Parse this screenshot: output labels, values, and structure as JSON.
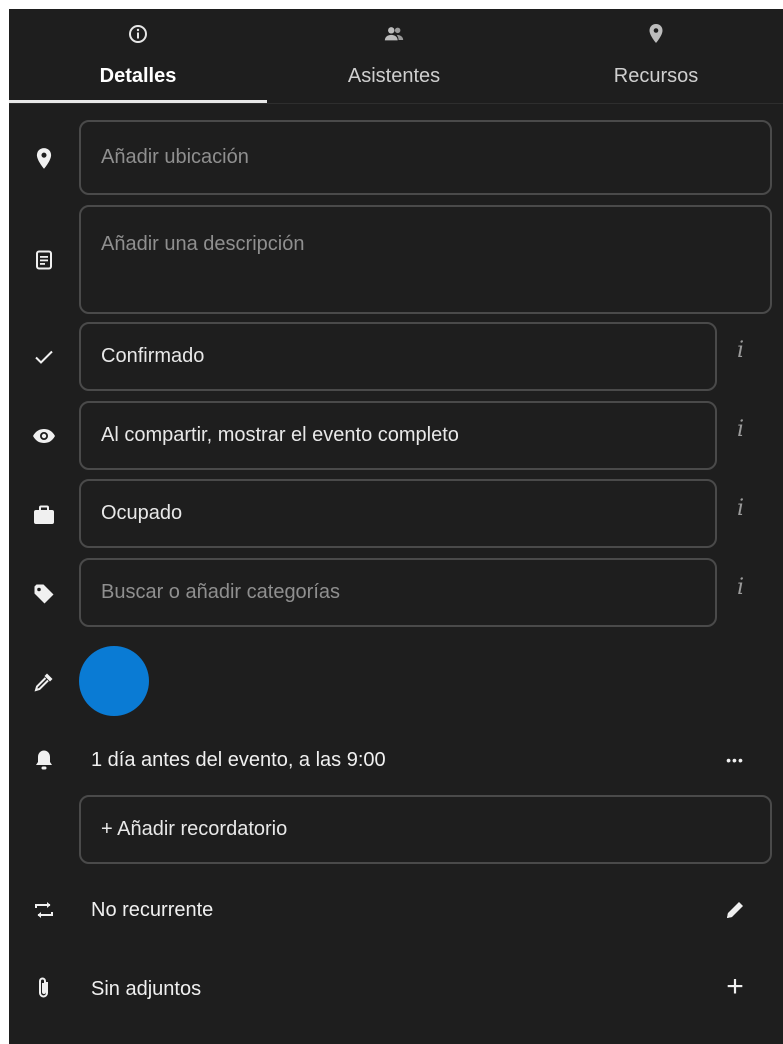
{
  "tabs": [
    {
      "label": "Detalles",
      "icon": "info-icon",
      "active": true
    },
    {
      "label": "Asistentes",
      "icon": "people-icon",
      "active": false
    },
    {
      "label": "Recursos",
      "icon": "location-pin-icon",
      "active": false
    }
  ],
  "location": {
    "placeholder": "Añadir ubicación",
    "icon": "location-pin-icon"
  },
  "description": {
    "placeholder": "Añadir una descripción",
    "icon": "note-icon"
  },
  "status": {
    "value": "Confirmado",
    "icon": "check-icon",
    "info": "i"
  },
  "visibility": {
    "value": "Al compartir, mostrar el evento completo",
    "icon": "eye-icon",
    "info": "i"
  },
  "availability": {
    "value": "Ocupado",
    "icon": "briefcase-icon",
    "info": "i"
  },
  "categories": {
    "placeholder": "Buscar o añadir categorías",
    "icon": "tag-icon",
    "info": "i"
  },
  "color": {
    "value": "#0a7bd4",
    "icon": "eyedropper-icon"
  },
  "reminder": {
    "text": "1 día antes del evento, a las 9:00",
    "icon": "bell-icon",
    "more": "•••"
  },
  "add_reminder": {
    "label": "+ Añadir recordatorio"
  },
  "recurrence": {
    "text": "No recurrente",
    "icon": "repeat-icon",
    "action_icon": "pencil-icon"
  },
  "attachments": {
    "text": "Sin adjuntos",
    "icon": "paperclip-icon",
    "action": "+"
  }
}
